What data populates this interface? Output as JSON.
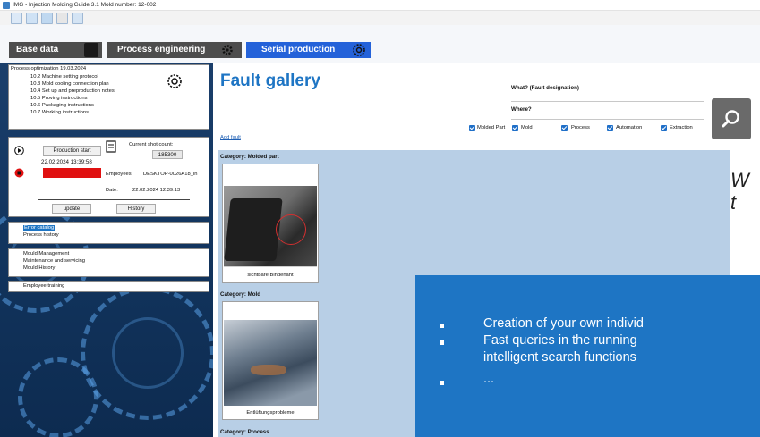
{
  "window": {
    "title": "IMG - Injection Molding Guide 3.1    Mold number: 12-002"
  },
  "tabs": [
    {
      "label": "Base data"
    },
    {
      "label": "Process engineering"
    },
    {
      "label": "Serial production"
    }
  ],
  "tree": {
    "root": "Process optimization 19.03.2024",
    "children": [
      "10.2 Machine setting protocol",
      "10.3 Mold cooling connection plan",
      "10.4 Set up and preproduction notes",
      "10.5 Proving instructions",
      "10.6 Packaging instructions",
      "10.7 Working instructions"
    ]
  },
  "production": {
    "start_label": "Production start",
    "start_date": "22.02.2024 13:39:58",
    "stop_label": "Production stop",
    "shot_count_label": "Current shot count:",
    "shot_count": "185300",
    "employees_label": "Employees:",
    "employees_value": "DESKTOP-0026A18_in",
    "date_label": "Date:",
    "date_value": "22.02.2024 12:39:13",
    "update_label": "update",
    "history_label": "History"
  },
  "catalog_links": [
    "Error catalog",
    "Process history"
  ],
  "mould_links": [
    "Mould Management",
    "Maintenance and servicing",
    "Mould History"
  ],
  "training_links": [
    "Employee training"
  ],
  "main": {
    "heading": "Fault gallery",
    "add_fault": "Add fault",
    "what_label": "What? (Fault designation)",
    "where_label": "Where?",
    "filters": [
      "Molded Part",
      "Mold",
      "Process",
      "Automation",
      "Extraction"
    ]
  },
  "gallery": [
    {
      "category": "Category: Molded part",
      "caption": "sichtbare Bindenaht"
    },
    {
      "category": "Category: Mold",
      "caption": "Entlüftungsprobleme"
    },
    {
      "category": "Category: Process",
      "caption": ""
    }
  ],
  "overlay": {
    "bullets": [
      "Creation of your own individ",
      "Fast queries in the running",
      "intelligent search functions",
      "..."
    ],
    "side_text": [
      "W",
      "t"
    ]
  },
  "colors": {
    "accent_blue": "#1e75c4",
    "active_tab": "#2462d9",
    "stop_red": "#e01010",
    "gallery_bg": "#b8cfe6"
  }
}
